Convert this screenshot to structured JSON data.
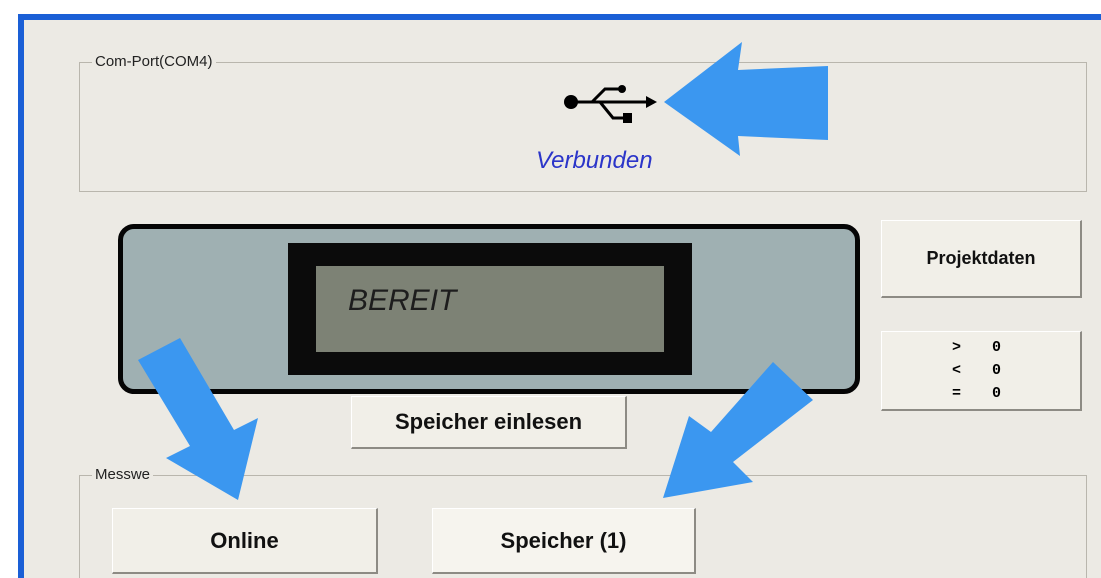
{
  "com_group": {
    "legend": "Com-Port(COM4)",
    "usb_icon": "usb-icon",
    "status": "Verbunden"
  },
  "lcd": {
    "text": "BEREIT"
  },
  "buttons": {
    "projektdaten": "Projektdaten",
    "speicher_einlesen": "Speicher einlesen",
    "online": "Online",
    "speicher": "Speicher (1)"
  },
  "counters": [
    {
      "symbol": ">",
      "value": "0"
    },
    {
      "symbol": "<",
      "value": "0"
    },
    {
      "symbol": "=",
      "value": "0"
    }
  ],
  "mess_group": {
    "legend": "Messwe"
  },
  "colors": {
    "accent_blue": "#1a5fd6",
    "status_text": "#2b35c9",
    "annotation_arrow": "#3b97f0"
  }
}
